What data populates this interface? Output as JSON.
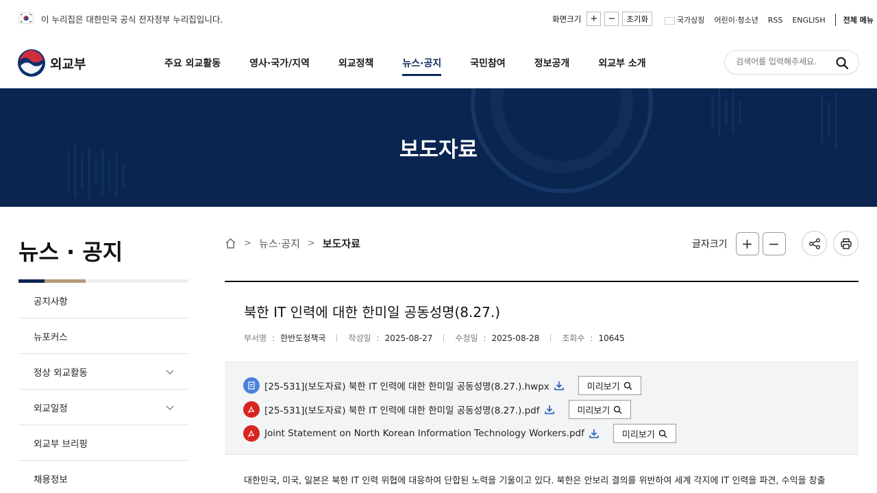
{
  "gov_bar": {
    "text": "이 누리집은 대한민국 공식 전자정부 누리집입니다.",
    "font_size_label": "화면크기",
    "plus": "+",
    "minus": "−",
    "reset": "초기화",
    "links": [
      "국가상징",
      "어린이·청소년",
      "RSS",
      "ENGLISH"
    ],
    "all_menu": "전체 메뉴"
  },
  "header": {
    "logo_text": "외교부",
    "nav": [
      "주요 외교활동",
      "영사·국가/지역",
      "외교정책",
      "뉴스·공지",
      "국민참여",
      "정보공개",
      "외교부 소개"
    ],
    "active_nav": "뉴스·공지",
    "search_placeholder": "검색어를 입력해주세요."
  },
  "hero": {
    "title": "보도자료"
  },
  "sidebar": {
    "title": "뉴스 · 공지",
    "items": [
      {
        "label": "공지사항",
        "expandable": false
      },
      {
        "label": "뉴포커스",
        "expandable": false
      },
      {
        "label": "정상 외교활동",
        "expandable": true
      },
      {
        "label": "외교일정",
        "expandable": true
      },
      {
        "label": "외교부 브리핑",
        "expandable": false
      },
      {
        "label": "채용정보",
        "expandable": false
      }
    ]
  },
  "breadcrumb": {
    "section": "뉴스·공지",
    "current": "보도자료"
  },
  "toolbar": {
    "font_size_label": "글자크기",
    "plus": "+",
    "minus": "−"
  },
  "article": {
    "title": "북한 IT 인력에 대한 한미일 공동성명(8.27.)",
    "meta": [
      {
        "key": "부서명",
        "value": "한반도정책국"
      },
      {
        "key": "작성일",
        "value": "2025-08-27"
      },
      {
        "key": "수정일",
        "value": "2025-08-28"
      },
      {
        "key": "조회수",
        "value": "10645"
      }
    ],
    "attachments": [
      {
        "name": "[25-531](보도자료) 북한 IT 인력에 대한 한미일 공동성명(8.27.).hwpx",
        "type": "hwp",
        "preview": "미리보기"
      },
      {
        "name": "[25-531](보도자료) 북한 IT 인력에 대한 한미일 공동성명(8.27.).pdf",
        "type": "pdf",
        "preview": "미리보기"
      },
      {
        "name": "Joint Statement on North Korean Information Technology Workers.pdf",
        "type": "pdf",
        "preview": "미리보기"
      }
    ],
    "body": "대한민국, 미국, 일본은 북한 IT 인력 위협에 대응하여 단합된 노력을 기울이고 있다. 북한은 안보리 결의를 위반하여 세계 각지에 IT 인력을 파견, 수익을 창출"
  }
}
